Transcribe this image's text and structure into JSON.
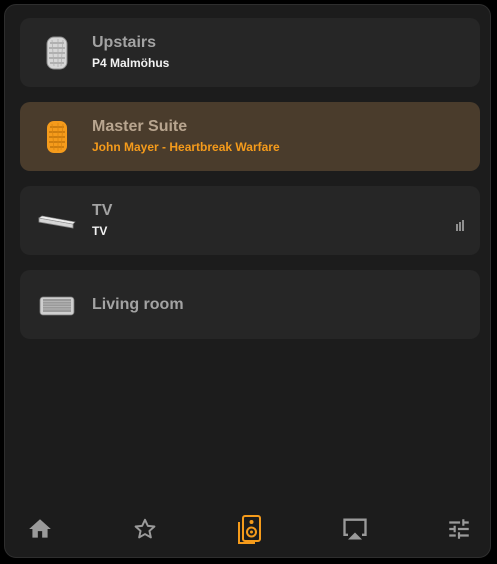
{
  "speakers": [
    {
      "name": "Upstairs",
      "now_playing": "P4 Malmöhus",
      "icon": "speaker-round-icon",
      "active": false
    },
    {
      "name": "Master Suite",
      "now_playing": "John Mayer - Heartbreak Warfare",
      "icon": "speaker-round-icon",
      "active": true
    },
    {
      "name": "TV",
      "now_playing": "TV",
      "icon": "soundbar-icon",
      "active": false,
      "indicator": "volume-bars-icon"
    },
    {
      "name": "Living room",
      "now_playing": "",
      "icon": "speaker-box-icon",
      "active": false
    }
  ],
  "nav": {
    "items": [
      {
        "name": "home",
        "icon": "home-icon",
        "active": false
      },
      {
        "name": "favorites",
        "icon": "star-icon",
        "active": false
      },
      {
        "name": "speakers",
        "icon": "speaker-icon",
        "active": true
      },
      {
        "name": "airplay",
        "icon": "airplay-icon",
        "active": false
      },
      {
        "name": "settings",
        "icon": "sliders-icon",
        "active": false
      }
    ]
  },
  "colors": {
    "background": "#1c1c1c",
    "card": "#262626",
    "active_card": "#4a3c2c",
    "accent": "#f59b1b",
    "icon_gray": "#9a9a9a"
  }
}
